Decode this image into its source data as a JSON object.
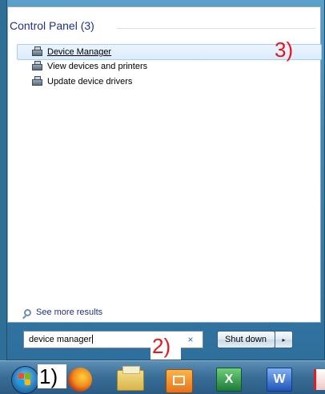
{
  "search_results": {
    "group_title": "Control Panel (3)",
    "items": [
      {
        "label": "Device Manager",
        "icon": "device-manager-icon",
        "selected": true
      },
      {
        "label": "View devices and printers",
        "icon": "printer-icon",
        "selected": false
      },
      {
        "label": "Update device drivers",
        "icon": "device-driver-icon",
        "selected": false
      }
    ],
    "see_more": "See more results"
  },
  "search": {
    "value": "device manager",
    "clear_label": "×"
  },
  "shutdown": {
    "label": "Shut down",
    "arrow": "▸"
  },
  "annotations": {
    "step1": "1)",
    "step2": "2)",
    "step3": "3)"
  },
  "taskbar": {
    "apps": [
      "start-orb-icon",
      "firefox-icon",
      "file-explorer-icon",
      "virtualbox-icon",
      "excel-icon",
      "word-icon",
      "pdf-icon"
    ],
    "excel_letter": "X",
    "word_letter": "W"
  },
  "colors": {
    "annotation_red": "#e8151a",
    "link_blue": "#1e3287",
    "selection_border": "#a9cff0"
  }
}
